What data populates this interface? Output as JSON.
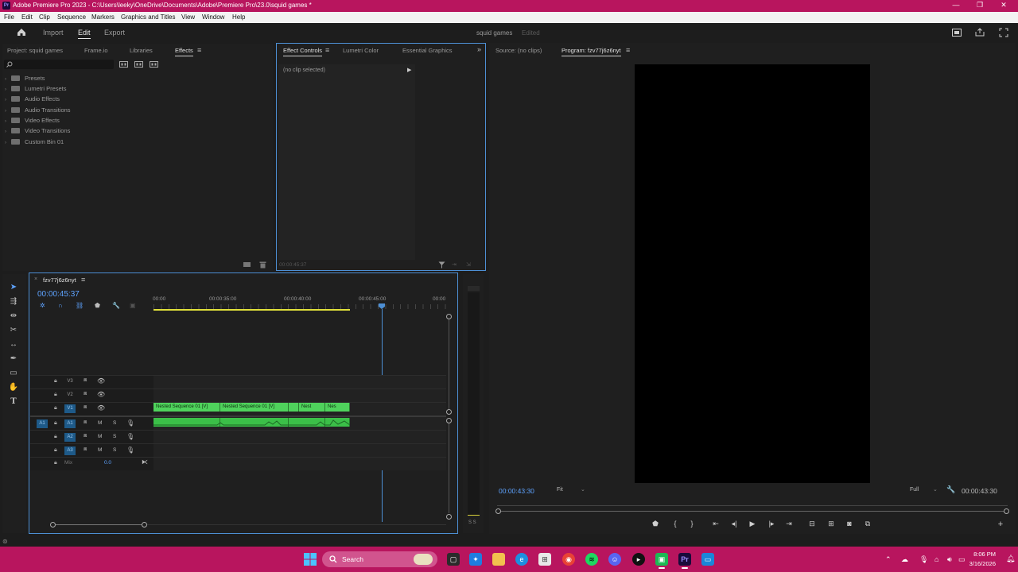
{
  "window": {
    "app_icon": "Pr",
    "title": "Adobe Premiere Pro 2023 - C:\\Users\\leeky\\OneDrive\\Documents\\Adobe\\Premiere Pro\\23.0\\squid games *",
    "controls": [
      "—",
      "❐",
      "✕"
    ]
  },
  "menu": [
    "File",
    "Edit",
    "Clip",
    "Sequence",
    "Markers",
    "Graphics and Titles",
    "View",
    "Window",
    "Help"
  ],
  "workspace": {
    "tabs": [
      "Import",
      "Edit",
      "Export"
    ],
    "active": "Edit",
    "project_name": "squid games",
    "project_status": "Edited"
  },
  "project_panel": {
    "tabs": [
      "Project: squid games",
      "Frame.io",
      "Libraries",
      "Effects"
    ],
    "active_tab": "Effects",
    "search_placeholder": "",
    "tree": [
      "Presets",
      "Lumetri Presets",
      "Audio Effects",
      "Audio Transitions",
      "Video Effects",
      "Video Transitions",
      "Custom Bin 01"
    ]
  },
  "effect_controls": {
    "tabs": [
      "Effect Controls",
      "Lumetri Color",
      "Essential Graphics"
    ],
    "active_tab": "Effect Controls",
    "no_clip": "(no clip selected)",
    "timecode": "00:00:45:37"
  },
  "source_monitor": {
    "tab": "Source: (no clips)"
  },
  "program_monitor": {
    "tab": "Program: fzv77j6z6nyt",
    "current_time": "00:00:43:30",
    "fit": "Fit",
    "resolution": "Full",
    "duration": "00:00:43:30"
  },
  "timeline": {
    "sequence_name": "fzv77j6z6nyt",
    "timecode": "00:00:45:37",
    "ruler": [
      "00:00",
      "00:00:35:00",
      "00:00:40:00",
      "00:00:45:00",
      "00:00"
    ],
    "video_tracks": [
      "V3",
      "V2",
      "V1"
    ],
    "audio_tracks": [
      "A1",
      "A2",
      "A3"
    ],
    "source_patch_audio": "A1",
    "mix_label": "Mix",
    "mix_value": "0.0",
    "clips": [
      "Nested Sequence 01 [V]",
      "Nested Sequence 01 [V]",
      "Nest",
      "Nes"
    ],
    "audio_meter_label": "S S"
  },
  "taskbar": {
    "search": "Search",
    "clock_time": "8:06 PM",
    "clock_date": "3/16/2026"
  },
  "colors": {
    "accent": "#b8155e",
    "clip_green": "#4fd25c",
    "timecode_blue": "#5ea3ff",
    "panel_border": "#4d8fd4"
  }
}
